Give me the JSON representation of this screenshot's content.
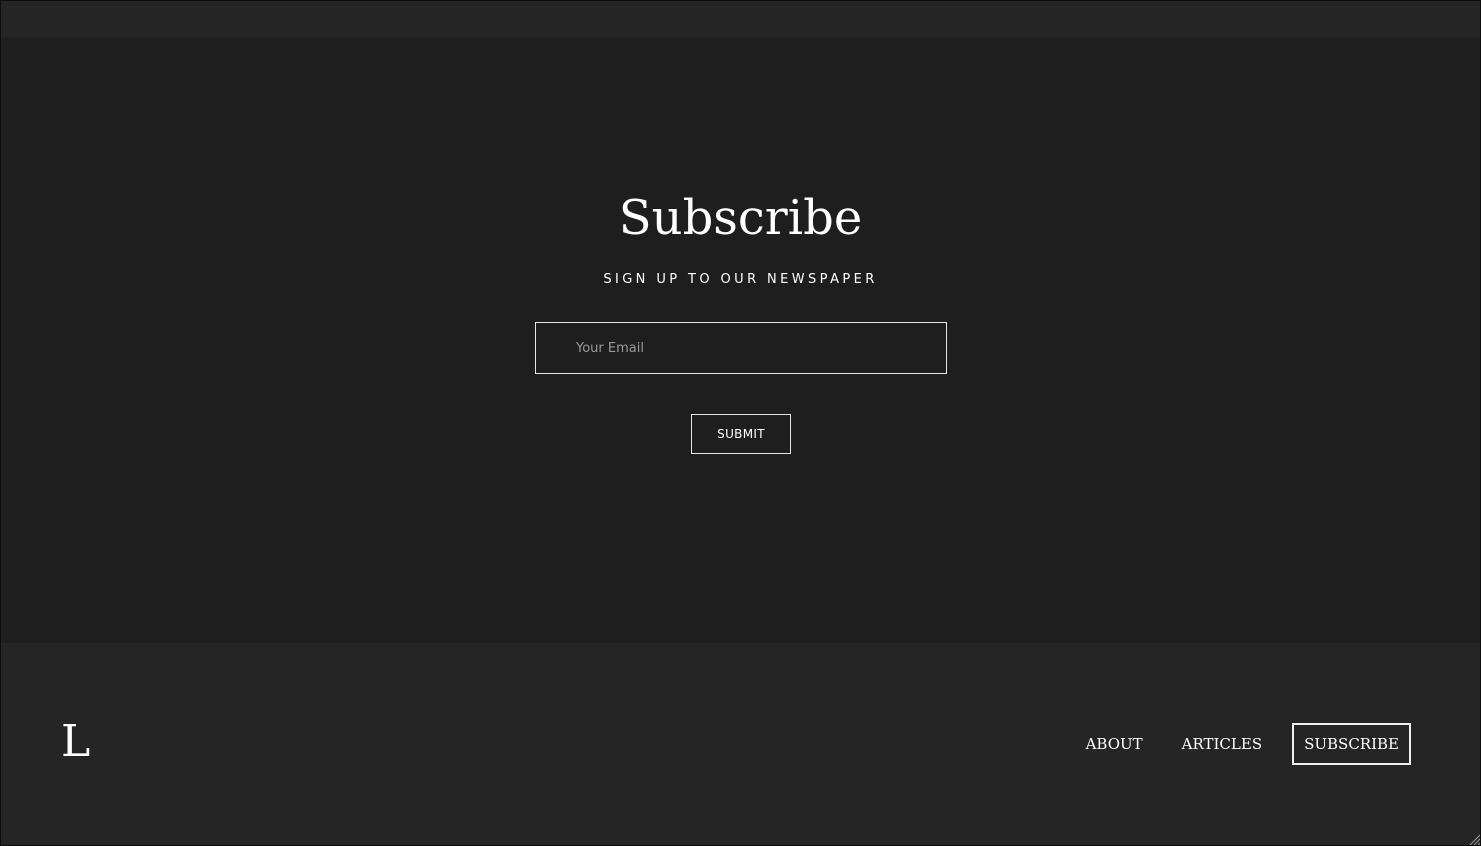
{
  "subscribe": {
    "title": "Subscribe",
    "subtitle": "SIGN UP TO OUR NEWSPAPER",
    "email_placeholder": "Your Email",
    "submit_label": "SUBMIT"
  },
  "footer": {
    "logo": "L",
    "nav": [
      {
        "label": "ABOUT"
      },
      {
        "label": "ARTICLES"
      },
      {
        "label": "SUBSCRIBE"
      }
    ]
  },
  "colors": {
    "page_background": "#1e1e1e",
    "footer_background": "#252525",
    "text": "#ffffff",
    "placeholder": "#9a9a9a"
  },
  "icons": {
    "resize_grip": "resize-grip-icon"
  }
}
